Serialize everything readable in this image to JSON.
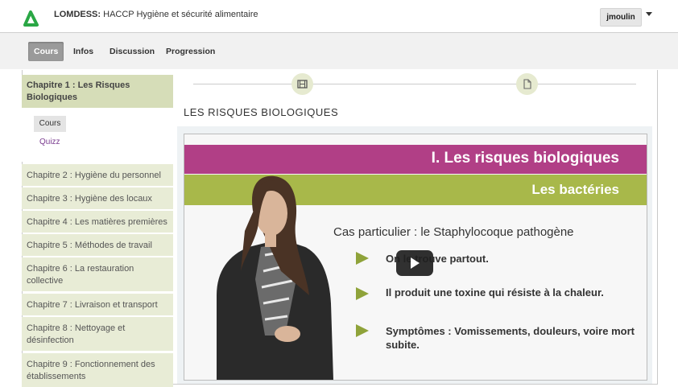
{
  "header": {
    "brand": "LOMDESS:",
    "course_title": "HACCP Hygiène et sécurité alimentaire",
    "username": "jmoulin",
    "brand_color": "#2aa745"
  },
  "tabs": [
    {
      "label": "Cours",
      "active": true
    },
    {
      "label": "Infos",
      "active": false
    },
    {
      "label": "Discussion",
      "active": false
    },
    {
      "label": "Progression",
      "active": false
    }
  ],
  "sidebar": {
    "active_chapter": "Chapitre 1 : Les Risques Biologiques",
    "lessons": [
      "Cours",
      "Quizz"
    ],
    "chapters": [
      "Chapitre 2 : Hygiène du personnel",
      "Chapitre 3 : Hygiène des locaux",
      "Chapitre 4 : Les matières premières",
      "Chapitre 5 : Méthodes de travail",
      "Chapitre 6 : La restauration collective",
      "Chapitre 7 : Livraison et transport",
      "Chapitre 8 : Nettoyage et désinfection",
      "Chapitre 9 : Fonctionnement des établissements"
    ]
  },
  "content": {
    "steps": [
      {
        "icon": "film-icon"
      },
      {
        "icon": "document-icon"
      }
    ],
    "lesson_title": "LES RISQUES BIOLOGIQUES",
    "video": {
      "slide_title": "I. Les risques biologiques",
      "slide_subtitle": "Les bactéries",
      "slide_heading": "Cas particulier : le Staphylocoque pathogène",
      "bullets": [
        "On le trouve partout.",
        "Il produit une toxine qui résiste à la chaleur.",
        "Symptômes : Vomissements, douleurs, voire mort subite."
      ],
      "play_icon": "play-icon",
      "colors": {
        "magenta": "#b13f86",
        "olive": "#a8b84a"
      }
    }
  }
}
